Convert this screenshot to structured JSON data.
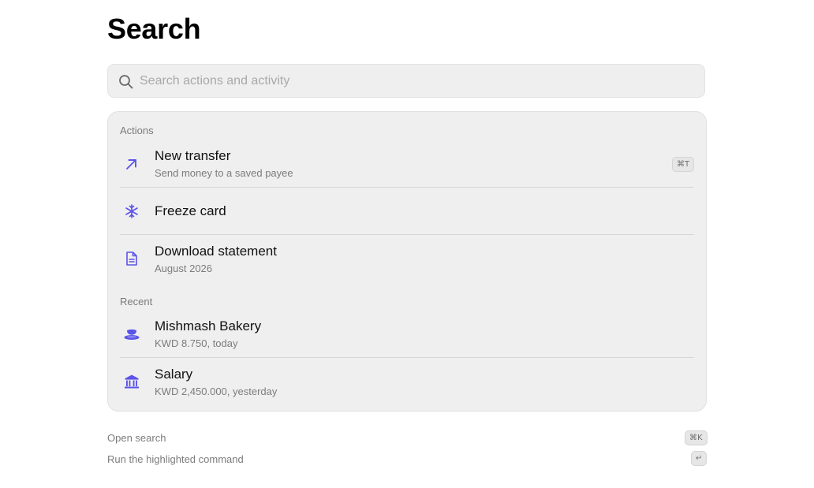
{
  "page": {
    "title": "Search"
  },
  "search": {
    "placeholder": "Search actions and activity",
    "value": ""
  },
  "actions": {
    "label": "Actions",
    "items": [
      {
        "name": "New transfer",
        "sub": "Send money to a saved payee",
        "shortcut": "⌘T",
        "icon": "arrow-up-right-icon"
      },
      {
        "name": "Freeze card",
        "sub": "",
        "icon": "snowflake-icon"
      },
      {
        "name": "Download statement",
        "sub": "August 2026",
        "icon": "document-icon"
      }
    ]
  },
  "recent": {
    "label": "Recent",
    "items": [
      {
        "name": "Mishmash Bakery",
        "sub": "KWD 8.750, today",
        "icon": "coffee-cup-icon"
      },
      {
        "name": "Salary",
        "sub": "KWD 2,450.000, yesterday",
        "icon": "bank-icon"
      }
    ]
  },
  "hints": [
    {
      "text": "Open search",
      "key": "⌘K"
    },
    {
      "text": "Run the highlighted command",
      "key": "↵"
    }
  ],
  "colors": {
    "accent": "#5b54e8",
    "panel_bg": "#efefef",
    "muted_text": "#7c7c7c"
  }
}
